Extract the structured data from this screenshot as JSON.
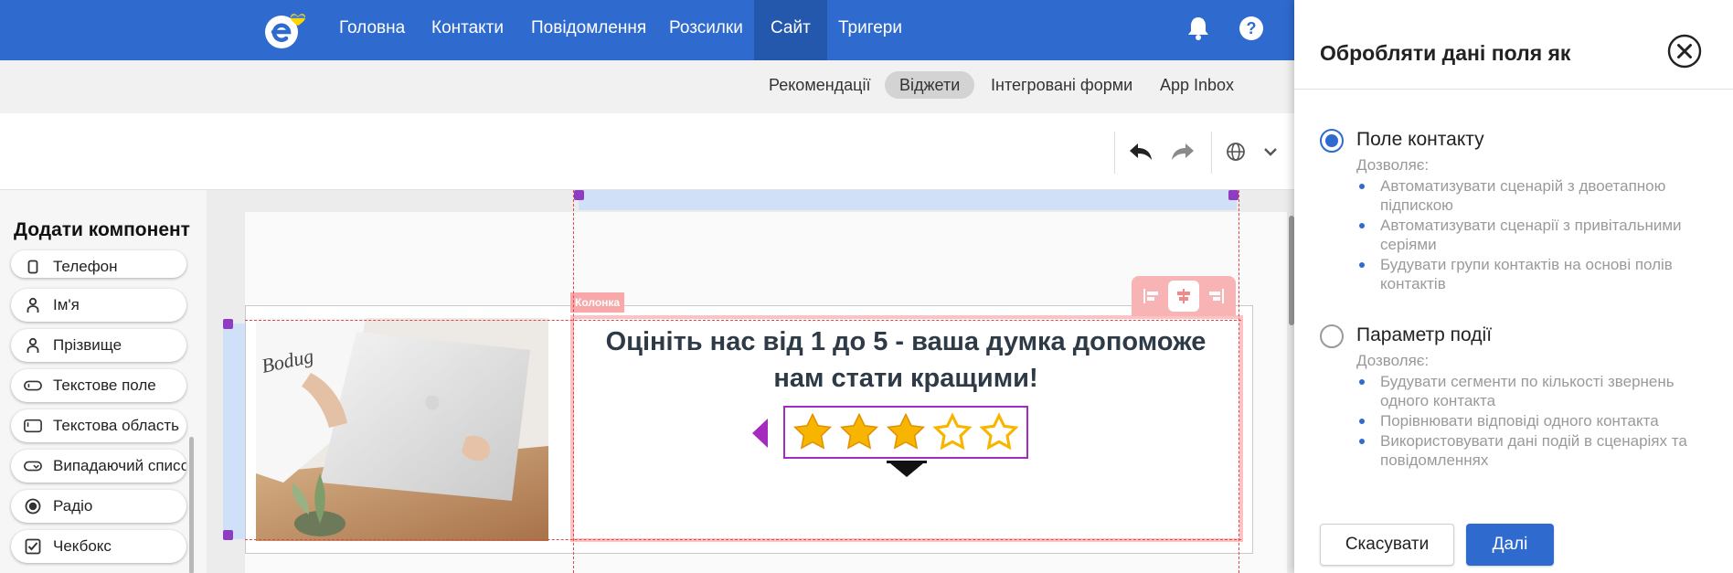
{
  "topnav": {
    "items": [
      {
        "label": "Головна"
      },
      {
        "label": "Контакти"
      },
      {
        "label": "Повідомлення"
      },
      {
        "label": "Розсилки"
      },
      {
        "label": "Сайт",
        "active": true
      },
      {
        "label": "Тригери"
      }
    ],
    "icons": [
      "bell-icon",
      "help-icon"
    ]
  },
  "subnav": {
    "items": [
      {
        "label": "Рекомендації"
      },
      {
        "label": "Віджети",
        "active": true
      },
      {
        "label": "Інтегровані форми"
      },
      {
        "label": "App Inbox"
      }
    ]
  },
  "toolbar": {
    "icons": [
      "undo-icon",
      "redo-icon",
      "globe-icon",
      "chevron-down-icon"
    ]
  },
  "left_panel": {
    "title": "Додати компонент",
    "components": [
      {
        "label": "Телефон",
        "icon": "phone-icon"
      },
      {
        "label": "Ім'я",
        "icon": "person-icon"
      },
      {
        "label": "Прізвище",
        "icon": "person-icon"
      },
      {
        "label": "Текстове поле",
        "icon": "text-field-icon"
      },
      {
        "label": "Текстова область",
        "icon": "text-area-icon"
      },
      {
        "label": "Випадаючий список",
        "icon": "dropdown-icon"
      },
      {
        "label": "Радіо",
        "icon": "radio-icon"
      },
      {
        "label": "Чекбокс",
        "icon": "checkbox-icon"
      }
    ]
  },
  "canvas": {
    "column_label": "Колонка",
    "headline": "Оцініть нас від 1 до 5 - ваша думка допоможе нам стати кращими!",
    "rating": {
      "filled": 3,
      "total": 5
    },
    "align_tools": [
      "align-left-icon",
      "align-center-icon",
      "align-right-icon"
    ],
    "photo_caption": "Bodug"
  },
  "modal": {
    "title": "Обробляти дані поля як",
    "options": [
      {
        "title": "Поле контакту",
        "checked": true,
        "allows_label": "Дозволяє:",
        "items": [
          "Автоматизувати сценарій з двоетапною підпискою",
          "Автоматизувати сценарії з привітальними серіями",
          "Будувати групи контактів на основі полів контактів"
        ]
      },
      {
        "title": "Параметр події",
        "checked": false,
        "allows_label": "Дозволяє:",
        "items": [
          "Будувати сегменти по кількості звернень одного контакта",
          "Порівнювати відповіді одного контакта",
          "Використовувати дані подій в сценаріях та повідомленнях"
        ]
      }
    ],
    "cancel_label": "Скасувати",
    "next_label": "Далі"
  },
  "colors": {
    "brand_blue": "#2f6bcf",
    "selection_purple": "#a52bbf",
    "star_yellow": "#f7b500"
  }
}
